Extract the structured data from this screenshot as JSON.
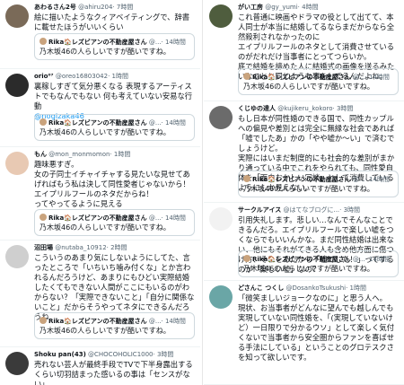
{
  "quote": {
    "name": "Rika🏠レズビアンの不動産屋さん",
    "handle": "@...",
    "time": "· 14時間",
    "text": "乃木坂46の人らしいですが酷いですね。"
  },
  "left": [
    {
      "name": "あわるさん2号",
      "handle": "@ahiru204",
      "time": "· 7時間",
      "lines": [
        "絵に描いたようなクィアベイティングで、辞書に載せたほうがいいくらい"
      ],
      "avatar_color": "#7a6a58"
    },
    {
      "name": "orio⁰⁷",
      "handle": "@oreo16803042",
      "time": "· 1時間",
      "lines": [
        "裏稼しすぎて気分悪くなる 表現するアーティストでもなんでもない 何も考えていない安易な行動"
      ],
      "mention": "@nogizaka46",
      "avatar_color": "#2b2b2b"
    },
    {
      "name": "もん",
      "handle": "@mon_monmomon",
      "time": "· 1時間",
      "lines": [
        "趣味悪すぎ。",
        "女の子同士イチャイチャする見たいな見せてあげればもう私は決して同性愛者じゃないから！エイプリルフールのネタだからね！",
        "ってやってるように見える"
      ],
      "avatar_color": "#e8c9b3"
    },
    {
      "name": "沼田場",
      "handle": "@nutaba_10912",
      "time": "· 2時間",
      "lines": [
        "こういうのあまり気にしないようにしてた、言ったところで「いちいち噛み付くな」とか言われるんだろうけど、あまりにもひどい実際結婚したくてもできない人間がここにもいるのがわからない？「実際できないこと」「自分に関係ないこと」だからそうやってネタにできるんだろうね"
      ],
      "avatar_color": "#cfcfcf"
    },
    {
      "name": "Shoku pan(43)",
      "handle": "@CHOCOHOLIC1000",
      "time": "· 3時間",
      "lines": [
        "売れない芸人が最終手段でTVで下半身露出するくらい切羽詰まった感いるの事は「センスがない」。"
      ],
      "avatar_color": "#3a3a3a"
    }
  ],
  "right": [
    {
      "name": "がい工房",
      "handle": "@gy_yumi",
      "time": "· 4時間",
      "lines": [
        "これ普通に映画やドラマの役として出てて、本人同士が本当に結婚してるならまだからなら全然殺利されなかったのに",
        "エイプリルフールのネタとして消費させているのがだれだけ当事者にとってつらいか。",
        "底で結婚を諦めた人に結婚式の画像を送るみたいなことと同じような事をしてるんだよね。"
      ],
      "avatar_color": "#4f5d3e"
    },
    {
      "name": "くじゆの達人",
      "handle": "@kujikeru_kokoro",
      "time": "· 3時間",
      "lines": [
        "もし日本が同性婚のできる国で、同性カップルへの偏見や差別とは完全に無縁な社会であれば「嘘でしたあ」かの「やや嘘か〜い」で済むでしょうけど。",
        "実際にはいまだ制度的にも社会的な差別がまかり通っている中でこれをやられても、同性愛自体を「面白おかしい冗談」として消費しているようにしか見えない。"
      ],
      "avatar_color": "#6b6b6b"
    },
    {
      "name": "サークルアイス",
      "handle": "@はてなブログに...",
      "time": "· 3時間",
      "lines": [
        "引用失礼します。悲しい…なんでそんなことできるんだろ。エイプリルフールで楽しい嘘をつくならでもいいんかな。まだ同性結婚は出来ない、他にもそれがてきる人も含め他方面に傷つけ方、それをあたかも「嘘でした！」ってするのが「楽しい嘘」なの？"
      ],
      "avatar_color": "#f2f2f2"
    },
    {
      "name": "どさんこ つくし",
      "handle": "@DosankoTsukushi",
      "time": "· 1時間",
      "lines": [
        "「微笑ましいジョークなのに」と思う人へ。",
        "現状、お当事者がどんなに望んでも越しんでも実現していない同性婚を、「(実現していないけど）一日限りで分かるウソ」として楽しく気付くないで当事者から安全圏からファンを喜ばせる手法にしている」ということのグロテスクさを知って欲しいです。"
      ],
      "avatar_color": "#6aa6a6"
    }
  ]
}
